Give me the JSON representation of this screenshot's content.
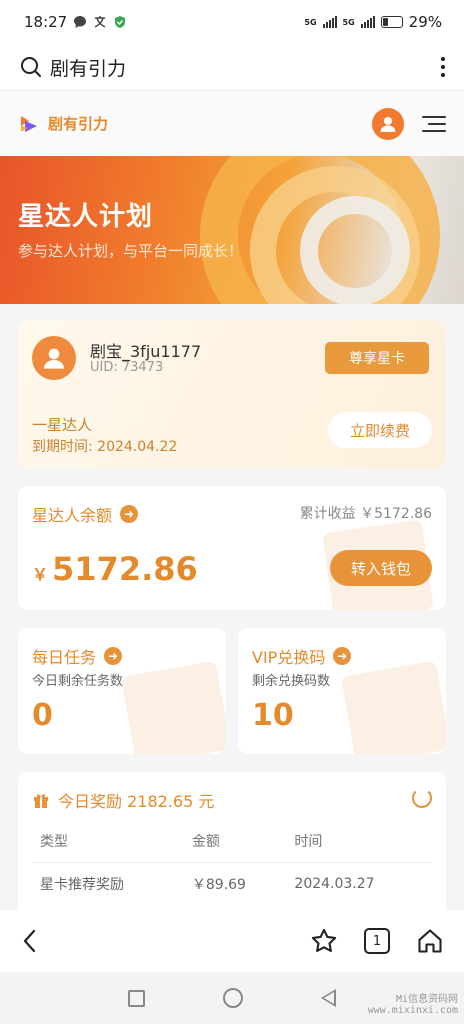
{
  "status_bar": {
    "time": "18:27",
    "net1": "5G",
    "net2": "5G",
    "battery": "29%"
  },
  "browser": {
    "title": "剧有引力",
    "tabs_count": "1"
  },
  "site": {
    "name": "剧有引力"
  },
  "banner": {
    "title": "星达人计划",
    "subtitle": "参与达人计划，与平台一同成长！"
  },
  "user": {
    "name": "剧宝_3fju1177",
    "uid": "UID: 73473",
    "star_card_button": "尊享星卡",
    "level": "一星达人",
    "expire": "到期时间: 2024.04.22",
    "renew_button": "立即续费"
  },
  "balance": {
    "title": "星达人余额",
    "total_label": "累计收益",
    "total_value": "￥5172.86",
    "currency": "￥",
    "amount": "5172.86",
    "wallet_button": "转入钱包"
  },
  "daily_task": {
    "title": "每日任务",
    "subtitle": "今日剩余任务数",
    "value": "0"
  },
  "vip_code": {
    "title": "VIP兑换码",
    "subtitle": "剩余兑换码数",
    "value": "10"
  },
  "reward": {
    "title": "今日奖励 2182.65 元",
    "columns": [
      "类型",
      "金额",
      "时间"
    ],
    "rows": [
      [
        "星卡推荐奖励",
        "￥89.69",
        "2024.03.27"
      ]
    ]
  },
  "watermark": {
    "line1": "Mi信息资码网",
    "line2": "www.mixinxi.com"
  },
  "colors": {
    "accent": "#e8933a",
    "brand_text": "#e58a2a"
  }
}
